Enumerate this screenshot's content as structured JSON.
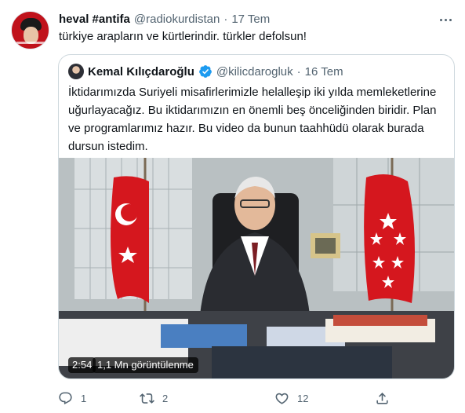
{
  "tweet": {
    "display_name": "heval #antifa",
    "handle": "@radiokurdistan",
    "separator": "·",
    "time": "17 Tem",
    "text": "türkiye arapların ve kürtlerindir. türkler defolsun!",
    "more_icon": "more-horizontal-icon"
  },
  "quoted": {
    "display_name": "Kemal Kılıçdaroğlu",
    "verified_icon": "verified-badge-icon",
    "handle": "@kilicdarogluk",
    "separator": "·",
    "time": "16 Tem",
    "text": "İktidarımızda Suriyeli misafirlerimizle helalleşip iki yılda memleketlerine uğurlayacağız. Bu iktidarımızın en önemli beş önceliğinden biridir. Plan ve programlarımız hazır. Bu video da bunun taahhüdü olarak burada dursun istedim.",
    "video": {
      "duration": "2:54",
      "views": "1,1 Mn görüntülenme"
    }
  },
  "actions": {
    "reply_count": "1",
    "retweet_count": "2",
    "like_count": "12",
    "reply_icon": "reply-icon",
    "retweet_icon": "retweet-icon",
    "like_icon": "heart-icon",
    "share_icon": "share-icon"
  },
  "colors": {
    "text": "#0f1419",
    "secondary": "#536471",
    "border": "#cfd9de",
    "verified": "#1d9bf0",
    "flag_red": "#d5171e"
  }
}
